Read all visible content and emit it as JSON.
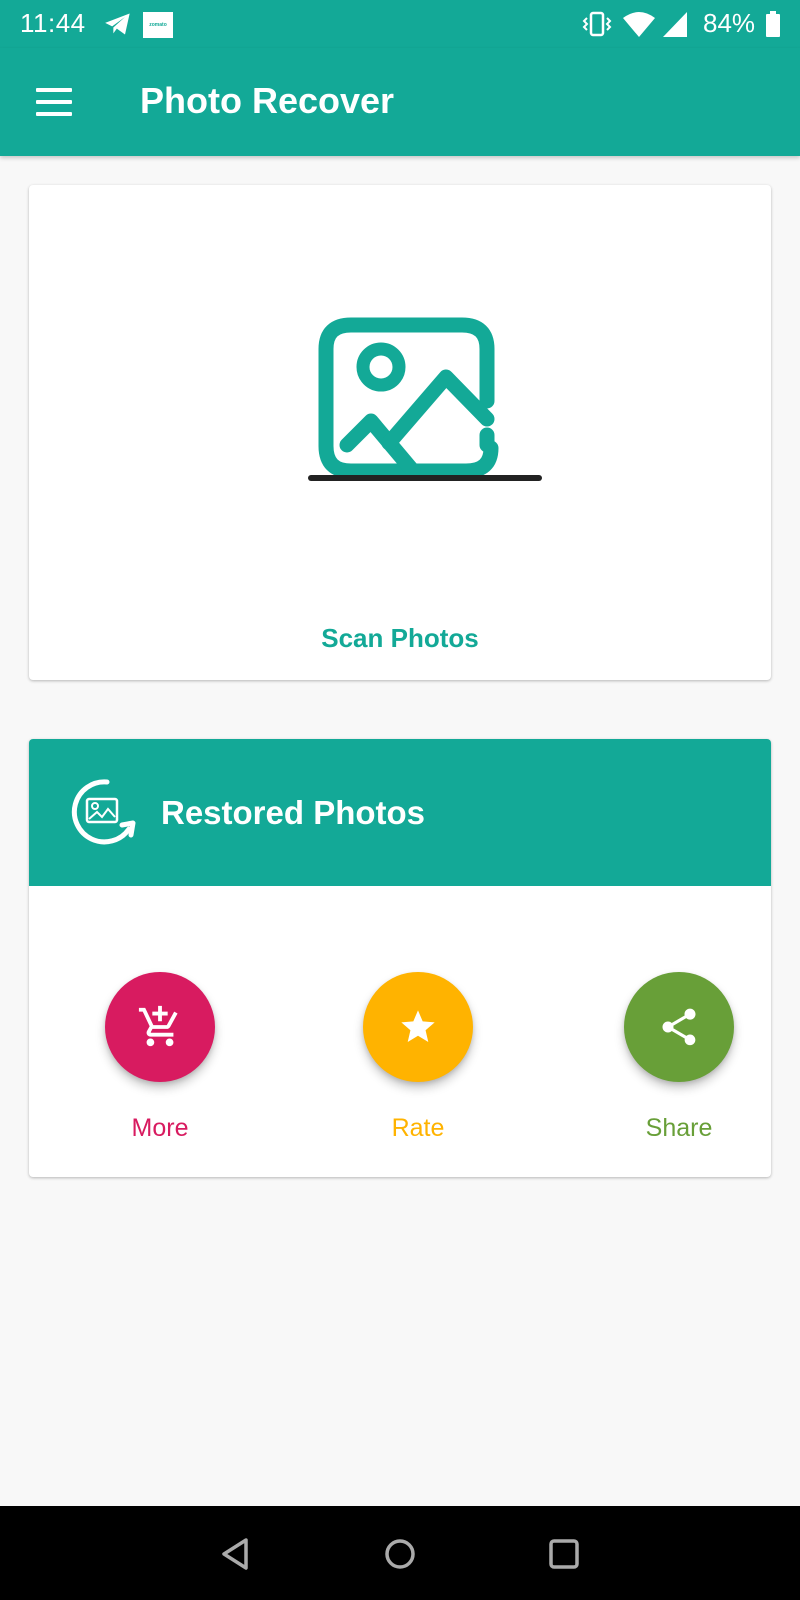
{
  "status_bar": {
    "time": "11:44",
    "notification_icons": [
      "telegram-icon",
      "zomato-icon"
    ],
    "zomato_text": "zomato",
    "system_icons": [
      "vibrate-icon",
      "wifi-icon",
      "signal-icon",
      "battery-icon"
    ],
    "battery_percent": "84%"
  },
  "app_bar": {
    "menu_icon": "hamburger-menu-icon",
    "title": "Photo Recover"
  },
  "scan_card": {
    "icon": "image-icon",
    "label": "Scan Photos"
  },
  "restored_card": {
    "icon": "restore-image-icon",
    "title": "Restored Photos",
    "actions": [
      {
        "label": "More",
        "icon": "add-to-cart-icon",
        "color": "#d81b60"
      },
      {
        "label": "Rate",
        "icon": "star-icon",
        "color": "#ffb300"
      },
      {
        "label": "Share",
        "icon": "share-icon",
        "color": "#689f38"
      }
    ]
  },
  "nav_bar": {
    "buttons": [
      "back",
      "home",
      "recents"
    ]
  },
  "colors": {
    "primary": "#13a997",
    "background": "#f8f8f8",
    "more": "#d81b60",
    "rate": "#ffb300",
    "share": "#689f38"
  }
}
